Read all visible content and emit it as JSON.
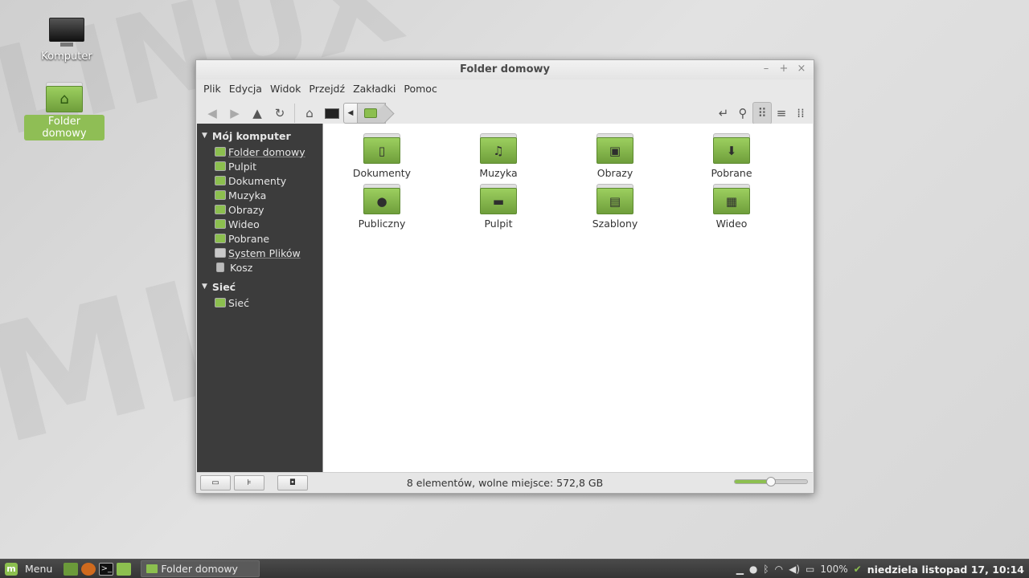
{
  "desktop": {
    "icons": [
      {
        "label": "Komputer",
        "icon": "monitor-icon"
      },
      {
        "label": "Folder domowy",
        "icon": "home-folder-icon"
      }
    ]
  },
  "window": {
    "title": "Folder domowy",
    "controls": {
      "minimize": "–",
      "maximize": "+",
      "close": "×"
    },
    "menu": [
      "Plik",
      "Edycja",
      "Widok",
      "Przejdź",
      "Zakładki",
      "Pomoc"
    ],
    "toolbar": {
      "back": "◀",
      "forward": "▶",
      "up": "▲",
      "reload": "↻",
      "home": "⌂",
      "computer": "▭",
      "crumb_left": "◀",
      "terminal": "↵",
      "search": "⚲",
      "icon_view": "⠿",
      "list_view": "≡",
      "compact_view": "⁞⁞"
    },
    "sidebar": {
      "sections": [
        {
          "title": "Mój komputer",
          "items": [
            "Folder domowy",
            "Pulpit",
            "Dokumenty",
            "Muzyka",
            "Obrazy",
            "Wideo",
            "Pobrane",
            "System Plików",
            "Kosz"
          ]
        },
        {
          "title": "Sieć",
          "items": [
            "Sieć"
          ]
        }
      ]
    },
    "folders": [
      {
        "name": "Dokumenty",
        "glyph": "▯"
      },
      {
        "name": "Muzyka",
        "glyph": "♫"
      },
      {
        "name": "Obrazy",
        "glyph": "▣"
      },
      {
        "name": "Pobrane",
        "glyph": "⬇"
      },
      {
        "name": "Publiczny",
        "glyph": "●"
      },
      {
        "name": "Pulpit",
        "glyph": "▬"
      },
      {
        "name": "Szablony",
        "glyph": "▤"
      },
      {
        "name": "Wideo",
        "glyph": "▦"
      }
    ],
    "status": {
      "text": "8 elementów, wolne miejsce: 572,8 GB",
      "zoom_fraction": 0.5,
      "btn_places": "▭",
      "btn_tree": "⊧",
      "btn_close_sidebar": "◘"
    }
  },
  "panel": {
    "menu_label": "Menu",
    "logo": "m",
    "task_label": "Folder domowy",
    "tray": {
      "battery": "100%",
      "clock": "niedziela listopad 17, 10:14"
    }
  },
  "colors": {
    "accent": "#8cbf4f",
    "sidebar_bg": "#3c3c3c",
    "panel_bg": "#3e3e3e"
  }
}
